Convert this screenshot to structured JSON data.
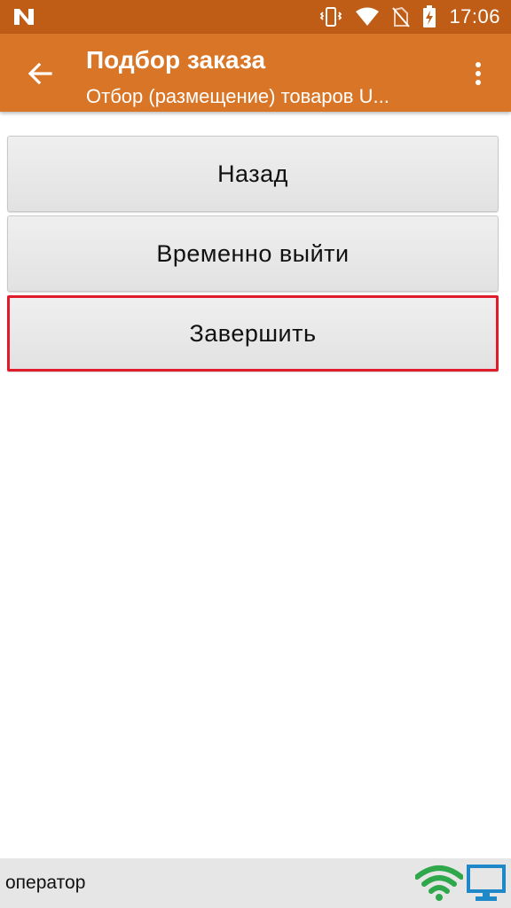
{
  "status_bar": {
    "time": "17:06",
    "icons": [
      "n-logo-icon",
      "vibrate-icon",
      "wifi-icon",
      "no-sim-icon",
      "battery-charging-icon"
    ]
  },
  "app_bar": {
    "title": "Подбор заказа",
    "subtitle": "Отбор (размещение) товаров U...",
    "back_icon": "arrow-back-icon",
    "menu_icon": "more-vert-icon"
  },
  "buttons": {
    "back_label": "Назад",
    "exit_label": "Временно выйти",
    "finish_label": "Завершить"
  },
  "bottom_bar": {
    "operator_label": "оператор",
    "icons": [
      "wifi-signal-icon",
      "monitor-icon"
    ]
  },
  "colors": {
    "status_bar": "#bf5d17",
    "app_bar": "#d87526",
    "highlight_border": "#e01b2c",
    "wifi_green": "#2ea84a",
    "monitor_blue": "#1e88c8"
  }
}
